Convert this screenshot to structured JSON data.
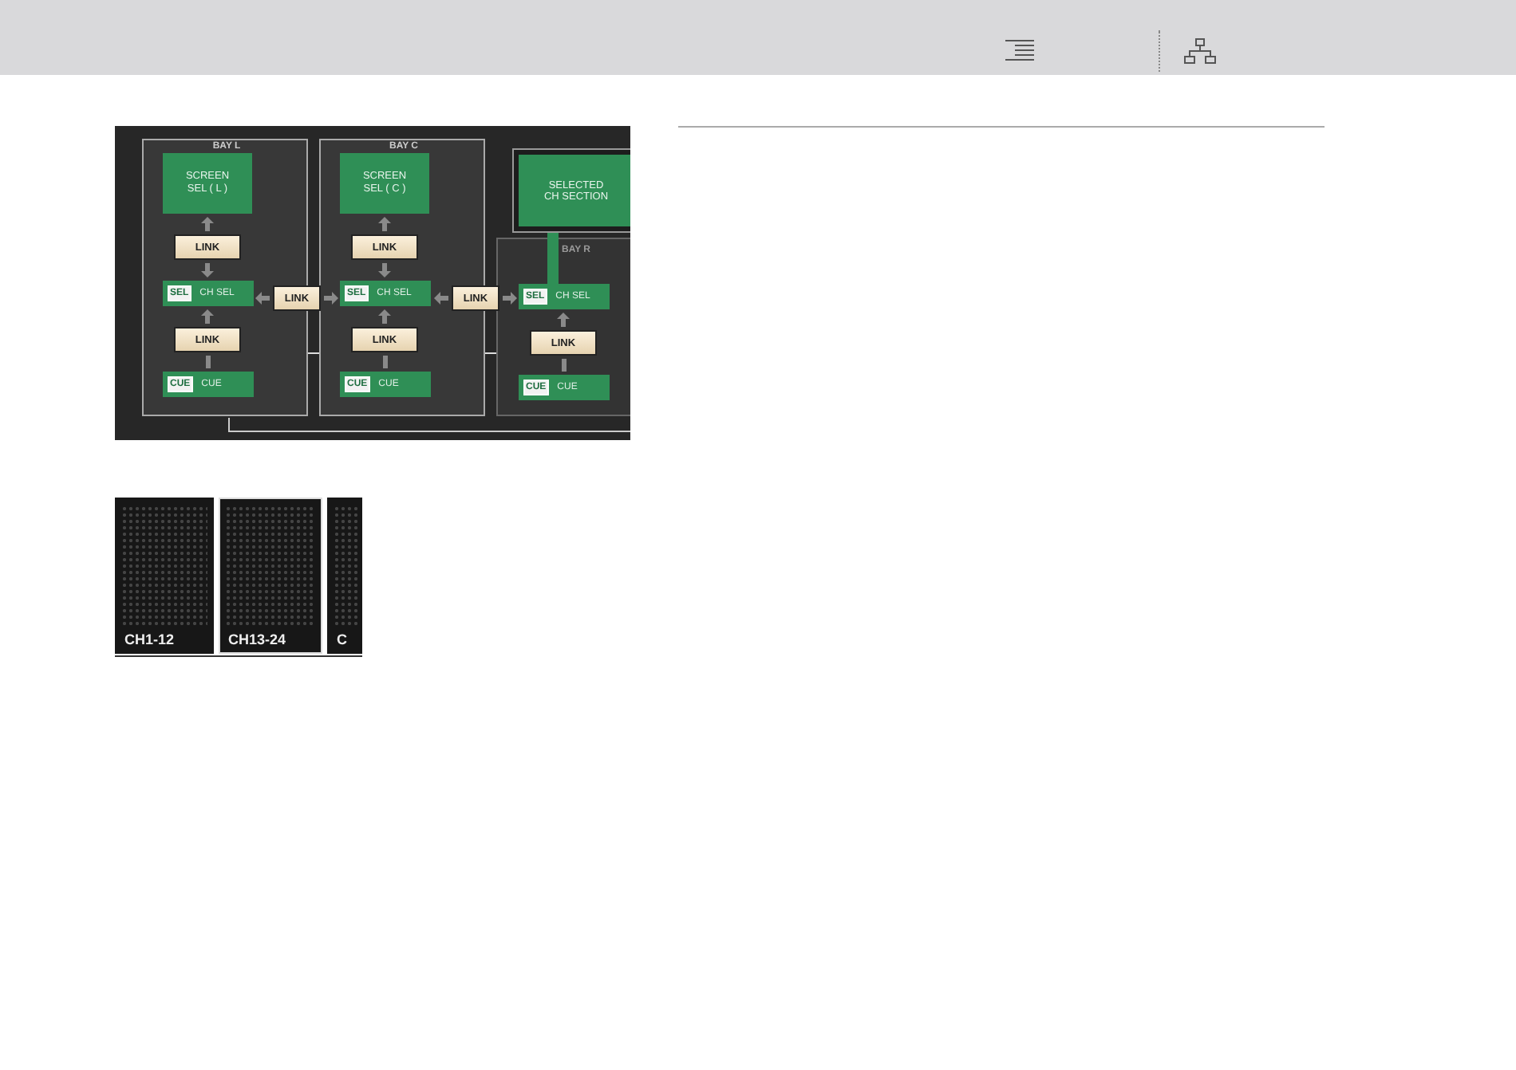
{
  "diagram": {
    "bays": [
      {
        "label": "BAY L",
        "kind": "screen",
        "screen_label": "SCREEN\nSEL ( L )",
        "link_top": "LINK",
        "sel_badge": "SEL",
        "sel_label": "CH SEL",
        "link_bottom": "LINK",
        "cue_badge": "CUE",
        "cue_label": "CUE"
      },
      {
        "label": "BAY C",
        "kind": "screen",
        "screen_label": "SCREEN\nSEL ( C )",
        "link_top": "LINK",
        "sel_badge": "SEL",
        "sel_label": "CH SEL",
        "link_bottom": "LINK",
        "cue_badge": "CUE",
        "cue_label": "CUE"
      },
      {
        "label": "BAY R",
        "kind": "selected",
        "section_label": "SELECTED\nCH SECTION",
        "sel_badge": "SEL",
        "sel_label": "CH SEL",
        "link_bottom": "LINK",
        "cue_badge": "CUE",
        "cue_label": "CUE"
      }
    ],
    "bay_links": [
      "LINK",
      "LINK"
    ]
  },
  "channel_panels": [
    {
      "label": "CH1-12",
      "selected": false
    },
    {
      "label": "CH13-24",
      "selected": true
    },
    {
      "label": "C",
      "selected": false
    }
  ]
}
